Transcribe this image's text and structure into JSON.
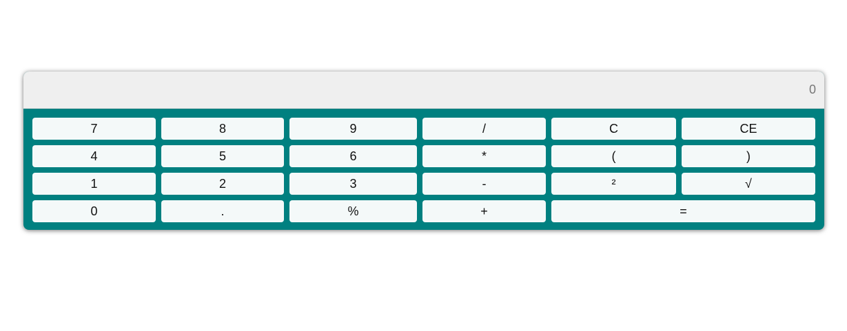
{
  "display": {
    "value": "0"
  },
  "keys": {
    "seven": "7",
    "eight": "8",
    "nine": "9",
    "divide": "/",
    "clear": "C",
    "clear_entry": "CE",
    "four": "4",
    "five": "5",
    "six": "6",
    "multiply": "*",
    "open_paren": "(",
    "close_paren": ")",
    "one": "1",
    "two": "2",
    "three": "3",
    "subtract": "-",
    "square": "²",
    "sqrt": "√",
    "zero": "0",
    "decimal": ".",
    "percent": "%",
    "add": "+",
    "equals": "="
  },
  "colors": {
    "keypad_background": "#008080",
    "display_background": "#efefef",
    "key_background": "#f4f9f9"
  }
}
